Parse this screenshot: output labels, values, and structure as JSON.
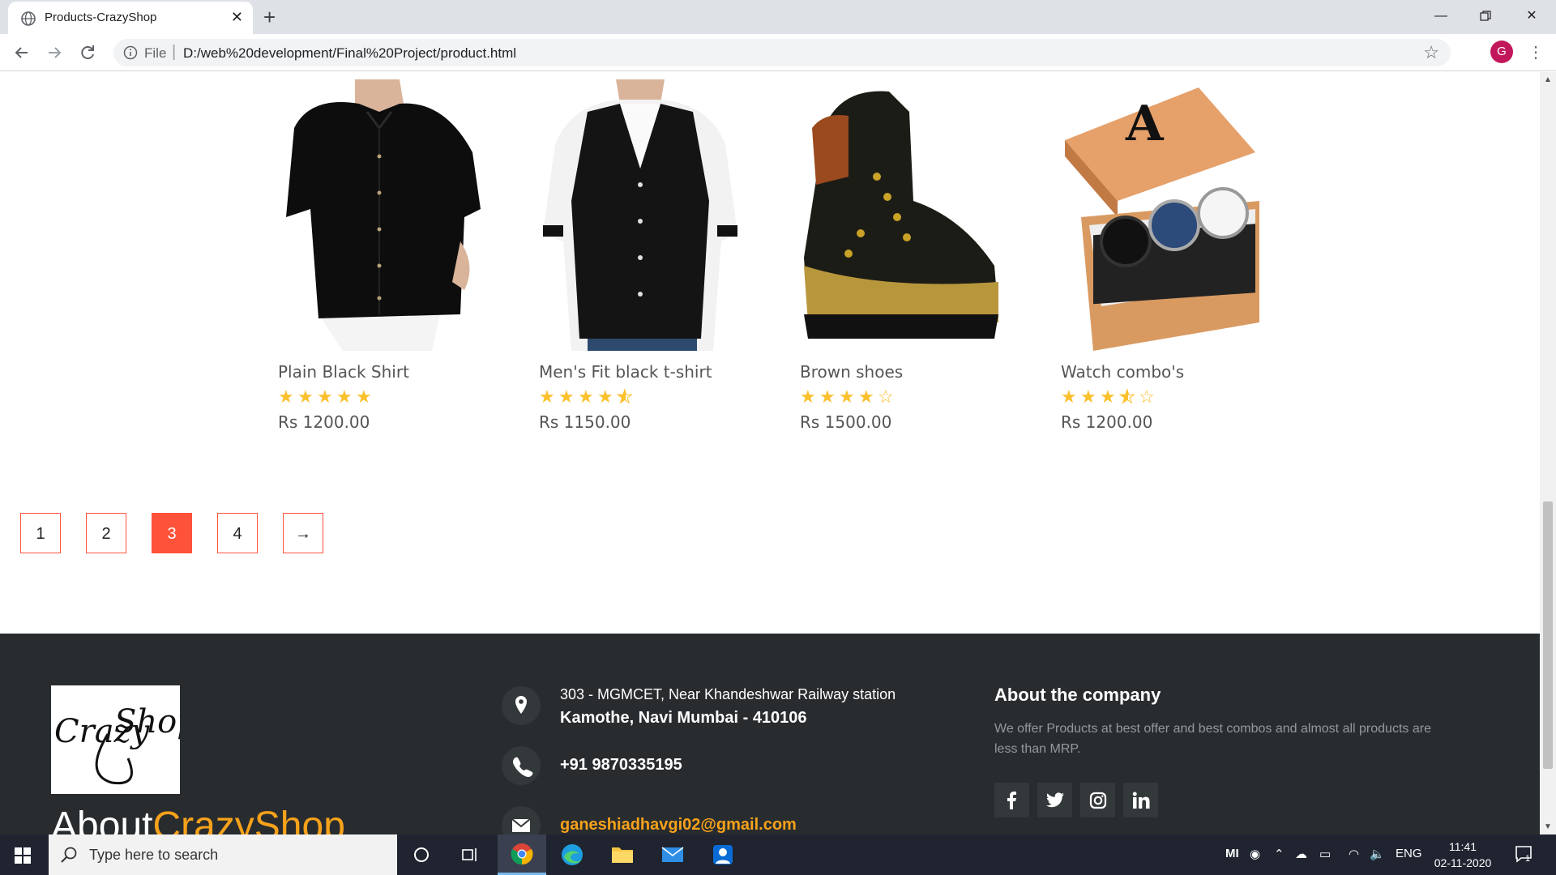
{
  "browser": {
    "tab_title": "Products-CrazyShop",
    "url_scheme_label": "File",
    "url": "D:/web%20development/Final%20Project/product.html",
    "profile_initial": "G"
  },
  "products": [
    {
      "name": "Plain Black Shirt",
      "rating": 5,
      "price": "Rs 1200.00",
      "image": "black-shirt"
    },
    {
      "name": "Men's Fit black t-shirt",
      "rating": 4.5,
      "price": "Rs 1150.00",
      "image": "fit-tshirt"
    },
    {
      "name": "Brown shoes",
      "rating": 4,
      "price": "Rs 1500.00",
      "image": "brown-shoes"
    },
    {
      "name": "Watch combo's",
      "rating": 3.5,
      "price": "Rs 1200.00",
      "image": "watch-combo"
    }
  ],
  "pagination": {
    "pages": [
      "1",
      "2",
      "3",
      "4"
    ],
    "active": "3",
    "next": "→"
  },
  "footer": {
    "logo_text": "CrazyShop",
    "about_prefix": "About",
    "about_brand": "CrazyShop",
    "address_line1": "303 - MGMCET, Near Khandeshwar Railway station",
    "address_line2": "Kamothe, Navi Mumbai - 410106",
    "phone": "+91 9870335195",
    "email": "ganeshiadhavgi02@gmail.com",
    "company_title": "About the company",
    "company_text": "We offer Products at best offer and best combos and almost all products are less than MRP.",
    "socials": [
      "facebook",
      "twitter",
      "instagram",
      "linkedin"
    ],
    "accent_color": "#f7a21b",
    "footer_bg": "#292c2f"
  },
  "taskbar": {
    "search_placeholder": "Type here to search",
    "language": "ENG",
    "time": "11:41",
    "date": "02-11-2020",
    "notification_count": "1"
  },
  "colors": {
    "pagination_accent": "#ff523b",
    "star_color": "#fbc02d"
  }
}
